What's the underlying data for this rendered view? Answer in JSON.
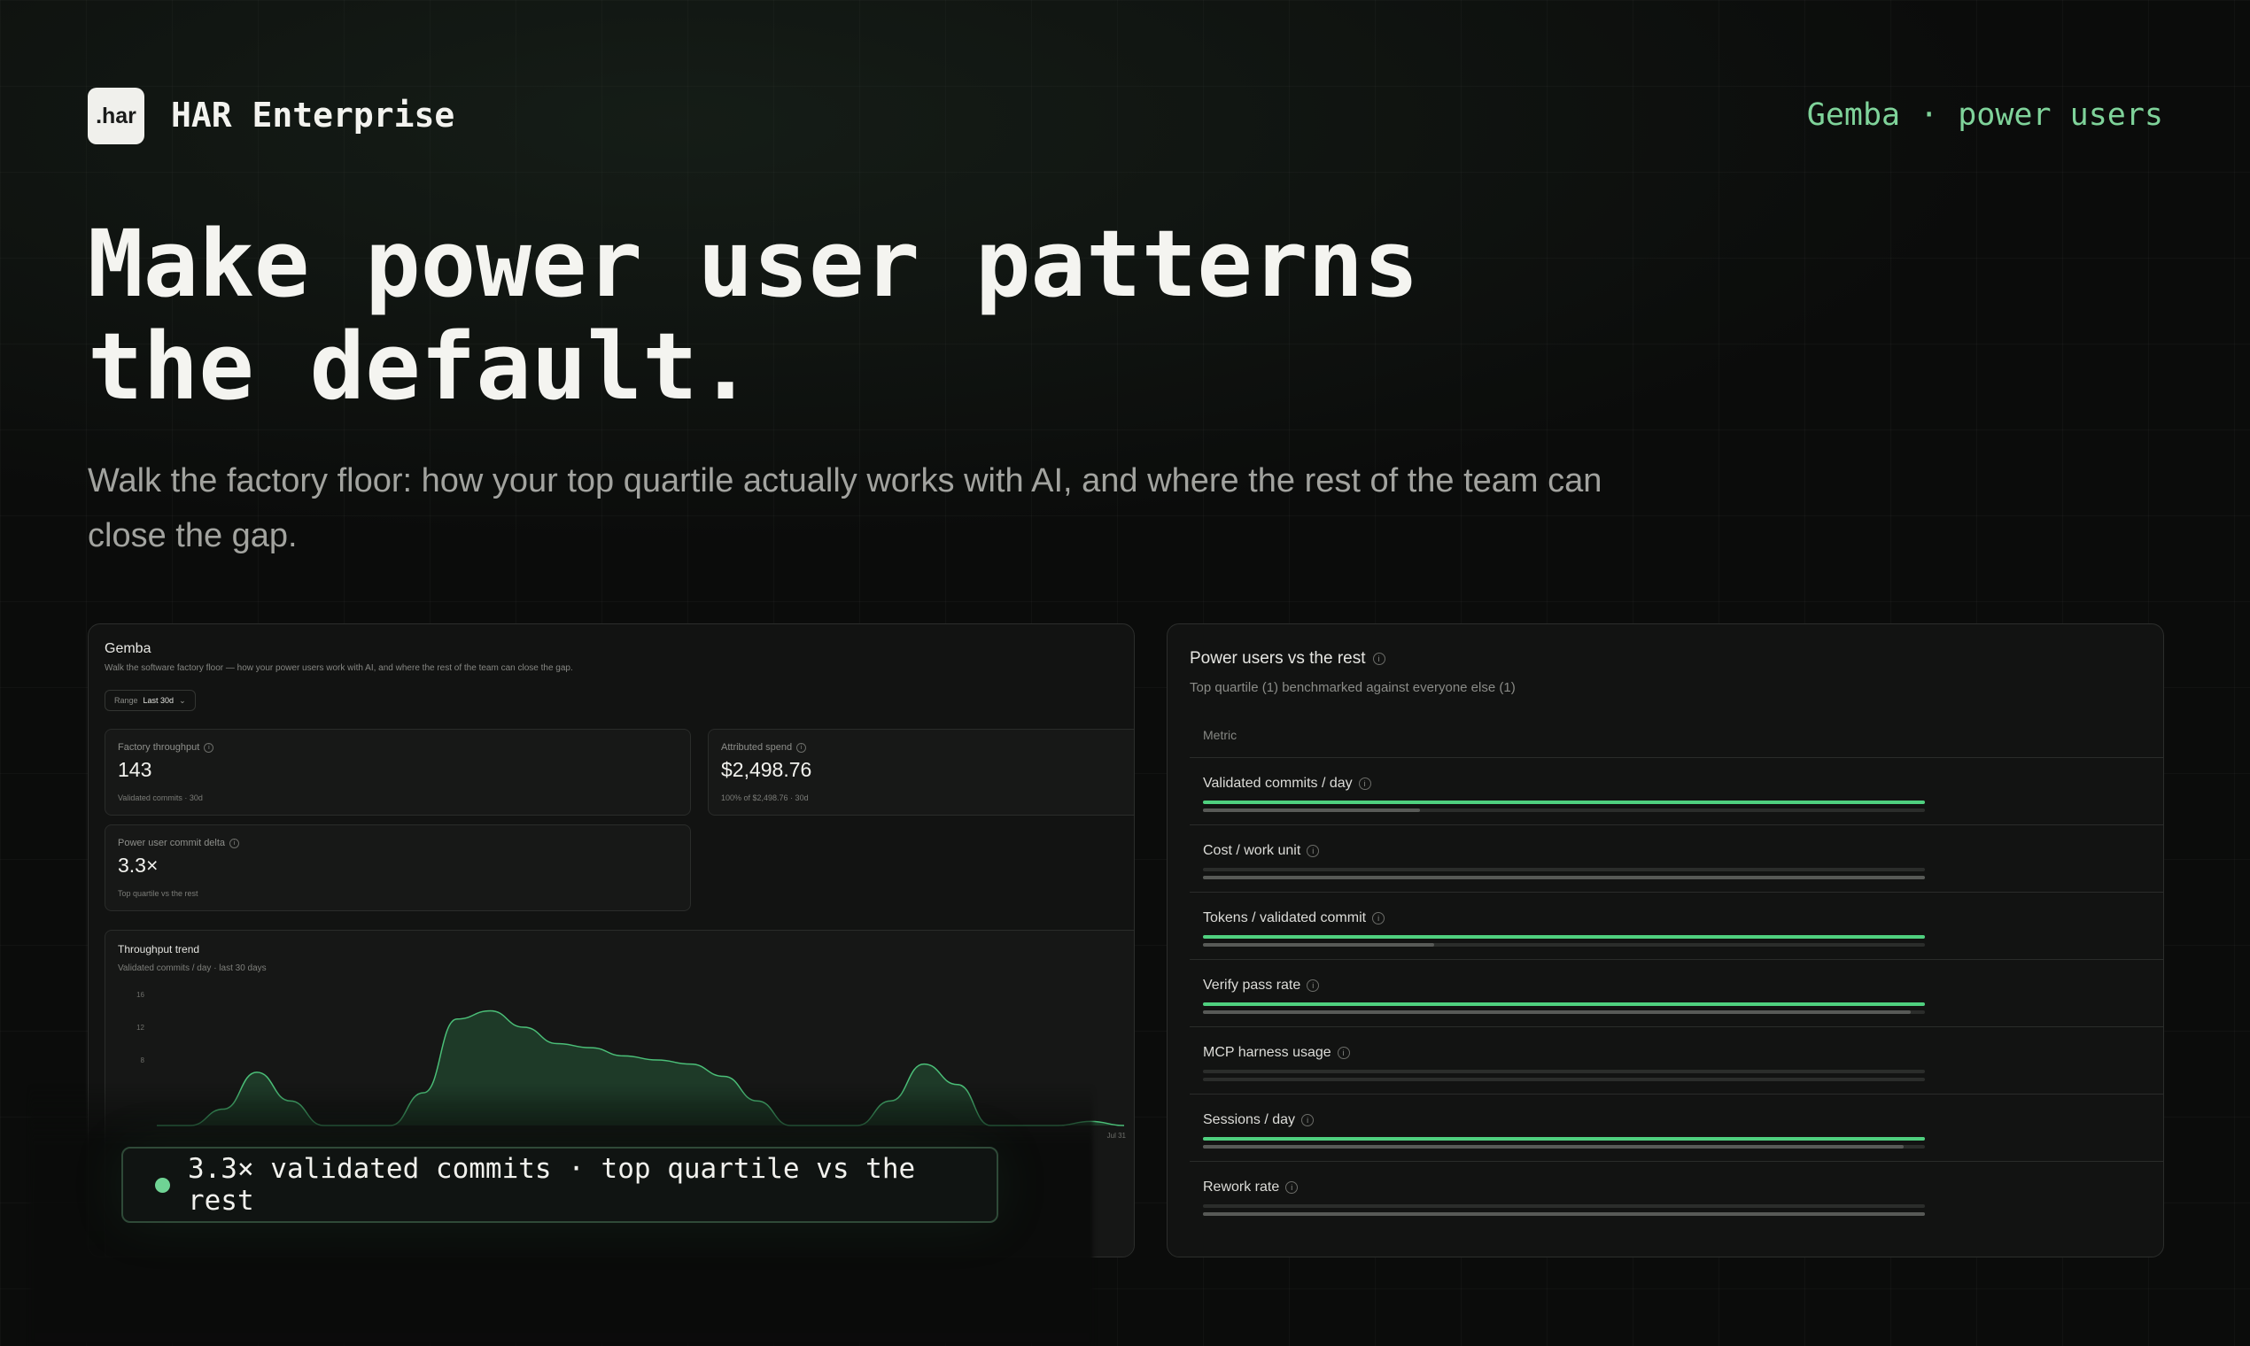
{
  "header": {
    "logo_text": ".har",
    "brand": "HAR Enterprise",
    "nav_left": "Gemba",
    "nav_sep": "·",
    "nav_right": "power users"
  },
  "hero": {
    "headline_line1": "Make power user patterns",
    "headline_line2": "the default.",
    "subline": "Walk the factory floor: how your top quartile actually works with AI, and where the rest of the team can close the gap."
  },
  "gemba_panel": {
    "title": "Gemba",
    "subtitle": "Walk the software factory floor — how your power users work with AI, and where the rest of the team can close the gap.",
    "range_label": "Range",
    "range_value": "Last 30d",
    "cards": [
      {
        "label": "Factory throughput",
        "value": "143",
        "foot": "Validated commits · 30d"
      },
      {
        "label": "Attributed spend",
        "value": "$2,498.76",
        "foot": "100% of $2,498.76 · 30d"
      },
      {
        "label": "Power user commit delta",
        "value": "3.3×",
        "foot": "Top quartile vs the rest"
      }
    ],
    "chart_title": "Throughput trend",
    "chart_sub": "Validated commits / day · last 30 days",
    "x_tick_end": "Jul 31"
  },
  "chart_data": {
    "type": "area",
    "title": "Throughput trend",
    "subtitle": "Validated commits / day · last 30 days",
    "y_ticks": [
      "16",
      "12",
      "8"
    ],
    "ylim": [
      0,
      16
    ],
    "x": [
      1,
      2,
      3,
      4,
      5,
      6,
      7,
      8,
      9,
      10,
      11,
      12,
      13,
      14,
      15,
      16,
      17,
      18,
      19,
      20,
      21,
      22,
      23,
      24,
      25,
      26,
      27,
      28,
      29,
      30
    ],
    "values": [
      0,
      0,
      2,
      6.5,
      3,
      0,
      0,
      0,
      4,
      13,
      14,
      12,
      10,
      9.5,
      8.5,
      8,
      7.5,
      6,
      3,
      0,
      0,
      0,
      3,
      7.5,
      5,
      0,
      0,
      0,
      0.5,
      0
    ],
    "x_tick_labels": [
      "Jul 31"
    ],
    "grid": false,
    "legend": "none",
    "colors": {
      "line": "#4bbf78",
      "fill": "#1e3a28"
    }
  },
  "callout": {
    "text": "3.3× validated commits · top quartile vs the rest",
    "dot_color": "#6fd394"
  },
  "power_panel": {
    "title": "Power users vs the rest",
    "subtitle": "Top quartile (1) benchmarked against everyone else (1)",
    "column_header": "Metric",
    "metrics": [
      {
        "label": "Validated commits / day",
        "top": 1.0,
        "rest": 0.3
      },
      {
        "label": "Cost / work unit",
        "top": 0.0,
        "rest": 1.0
      },
      {
        "label": "Tokens / validated commit",
        "top": 1.0,
        "rest": 0.32
      },
      {
        "label": "Verify pass rate",
        "top": 1.0,
        "rest": 0.98
      },
      {
        "label": "MCP harness usage",
        "top": 0.0,
        "rest": 0.0
      },
      {
        "label": "Sessions / day",
        "top": 1.0,
        "rest": 0.97
      },
      {
        "label": "Rework rate",
        "top": 0.0,
        "rest": 1.0
      }
    ]
  },
  "colors": {
    "accent": "#4fd07f",
    "background": "#0b0c0b",
    "nav_accent": "#7fd39a"
  }
}
